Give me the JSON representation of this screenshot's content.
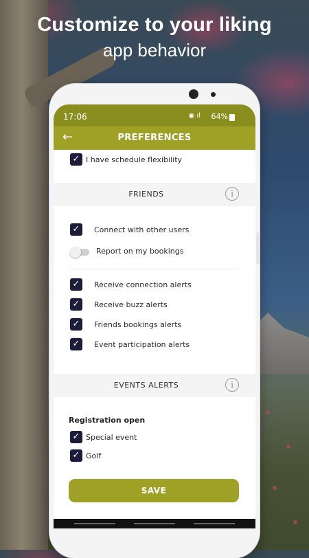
{
  "promo": {
    "headline": "Customize to your liking",
    "subline": "app behavior"
  },
  "status_bar": {
    "time": "17:06",
    "battery": "64%"
  },
  "nav": {
    "back_icon": "arrow-left-icon",
    "title": "PREFERENCES"
  },
  "general": {
    "schedule_flexibility": {
      "label": "I have schedule flexibility",
      "checked": true
    }
  },
  "friends_section": {
    "title": "FRIENDS",
    "info_icon": "info-icon",
    "connect_users": {
      "label": "Connect with other users",
      "checked": true
    },
    "report_bookings": {
      "label": "Report on my bookings",
      "enabled": false
    },
    "alerts": [
      {
        "label": "Receive connection alerts",
        "checked": true
      },
      {
        "label": "Receive buzz alerts",
        "checked": true
      },
      {
        "label": "Friends bookings alerts",
        "checked": true
      },
      {
        "label": "Event participation alerts",
        "checked": true
      }
    ]
  },
  "events_section": {
    "title": "EVENTS ALERTS",
    "info_icon": "info-icon",
    "registration_title": "Registration open",
    "items": [
      {
        "label": "Special event",
        "checked": true
      },
      {
        "label": "Golf",
        "checked": true
      }
    ]
  },
  "actions": {
    "save_label": "SAVE"
  },
  "colors": {
    "accent": "#9ea126",
    "checkbox": "#1e1c3b",
    "statusbar": "#8a8e1e"
  }
}
